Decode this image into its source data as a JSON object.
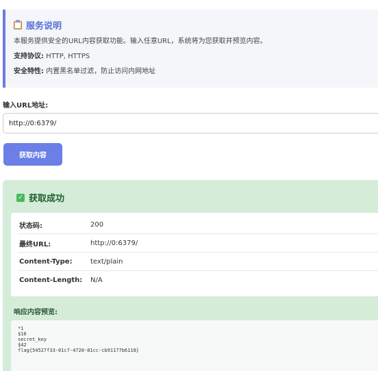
{
  "info": {
    "title": "服务说明",
    "description": "本服务提供安全的URL内容获取功能。输入任意URL，系统将为您获取并预览内容。",
    "protocols_label": "支持协议:",
    "protocols_value": " HTTP, HTTPS",
    "security_label": "安全特性:",
    "security_value": " 内置黑名单过滤，防止访问内网地址"
  },
  "form": {
    "url_label": "输入URL地址:",
    "url_value": "http://0:6379/",
    "button_label": "获取内容"
  },
  "result": {
    "title": "获取成功",
    "rows": [
      {
        "key": "状态码:",
        "value": "200"
      },
      {
        "key": "最终URL:",
        "value": "http://0:6379/"
      },
      {
        "key": "Content-Type:",
        "value": "text/plain"
      },
      {
        "key": "Content-Length:",
        "value": "N/A"
      }
    ],
    "preview_label": "响应内容预览:",
    "preview_text": "*1\n$10\nsecret_key\n$42\nflag{54527f33-01c7-4720-81cc-cb91177b6118}"
  }
}
